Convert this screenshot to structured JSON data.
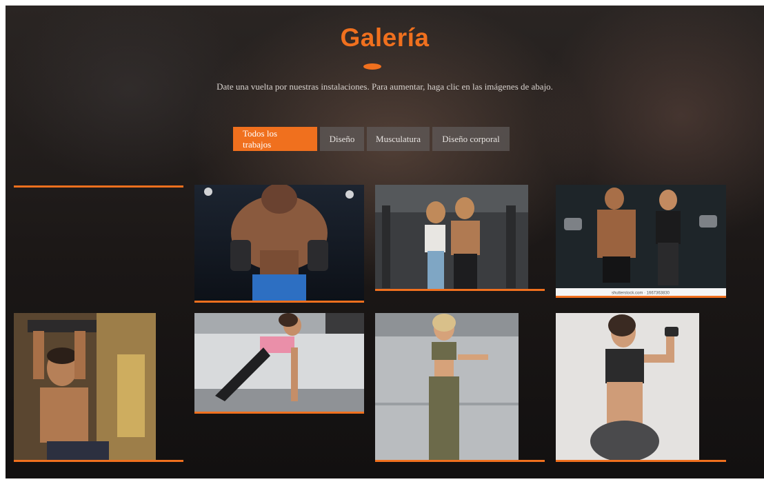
{
  "header": {
    "title": "Galería",
    "subtitle": "Date una vuelta por nuestras instalaciones. Para aumentar, haga clic en las imágenes de abajo."
  },
  "filters": [
    {
      "label": "Todos los trabajos",
      "active": true
    },
    {
      "label": "Diseño",
      "active": false
    },
    {
      "label": "Musculatura",
      "active": false
    },
    {
      "label": "Diseño corporal",
      "active": false
    }
  ],
  "gallery": {
    "items": [
      {
        "alt": "empty-slot"
      },
      {
        "alt": "bodybuilder-dumbbells"
      },
      {
        "alt": "couple-gym"
      },
      {
        "alt": "couple-dumbbells",
        "caption": "shutterstock.com · 1667363830"
      },
      {
        "alt": "man-pullup"
      },
      {
        "alt": "woman-pushup"
      },
      {
        "alt": "woman-athleisure"
      },
      {
        "alt": "woman-dumbbell-curl"
      }
    ]
  },
  "colors": {
    "accent": "#f0701e",
    "background": "#1b1716",
    "button_inactive": "#5f5a58"
  }
}
